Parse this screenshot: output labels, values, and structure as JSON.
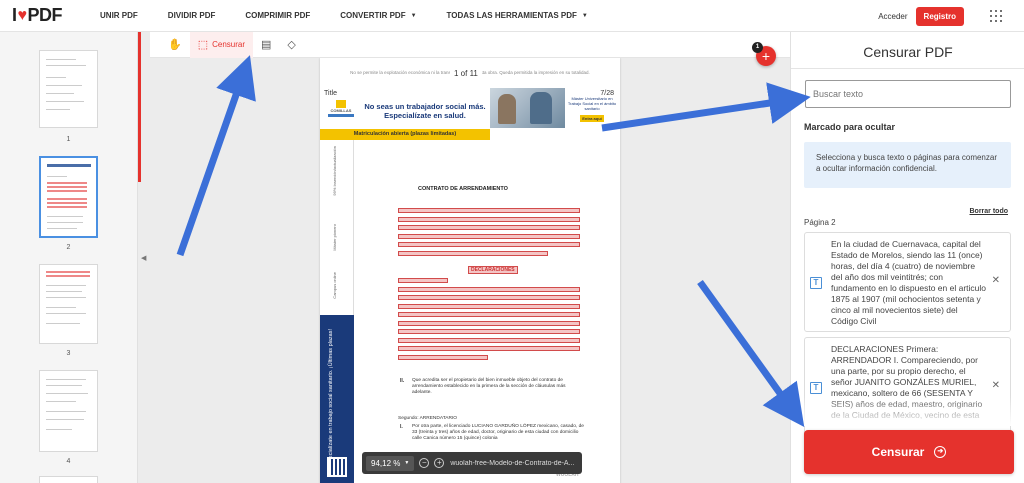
{
  "brand": {
    "logo_left": "I",
    "logo_right": "PDF",
    "accent": "#e5322d"
  },
  "nav": {
    "items": [
      {
        "label": "UNIR PDF"
      },
      {
        "label": "DIVIDIR PDF"
      },
      {
        "label": "COMPRIMIR PDF"
      },
      {
        "label": "CONVERTIR PDF"
      },
      {
        "label": "TODAS LAS HERRAMIENTAS PDF"
      }
    ],
    "login": "Acceder",
    "register": "Registro"
  },
  "thumbnails": [
    {
      "label": "1",
      "selected": false
    },
    {
      "label": "2",
      "selected": true
    },
    {
      "label": "3",
      "selected": false
    },
    {
      "label": "4",
      "selected": false
    }
  ],
  "toolbar": {
    "censor_label": "Censurar"
  },
  "document": {
    "header_line": "No se permite la explotación económica ni la transformación de esta obra. Queda permitida la impresión en su totalidad.",
    "page_counter": "1 of 11",
    "banner_title": "Title",
    "banner_page": "7/28",
    "banner_logo": "COMILLAS",
    "slogan": "No seas un trabajador social más. Especialízate en salud.",
    "side_ad": "Máster Universitario en Trabajo Social en el ámbito sanitario",
    "side_ad_cta": "Entra aquí",
    "enrollment": "Matriculación abierta (plazas limitadas)",
    "side_labels": [
      "99% Inserción/actualización",
      "Máster pionero",
      "Campus online"
    ],
    "blue_col_text": "Especialízate en trabajo social sanitario. ¡Últimas plazas!",
    "heading": "CONTRATO DE ARRENDAMIENTO",
    "declarations": "DECLARACIONES",
    "first_para": "Que acredita ser el propietario del bien inmueble objeto del contrato de arrendamiento establecido en la primera de la sección de cláusulas más adelante.",
    "roman_2": "II.",
    "second_heading": "Segundo: ARRENDATARIO",
    "roman_1": "I.",
    "second_para": "Por otra parte, el licenciado LUCIANO GARDUÑO LÓPEZ mexicano, casado, de 33 (treinta y tres) años de edad, doctor, originario de esta ciudad con domicilio calle Canica número 15 (quince) colonia",
    "footer_brand": "WUOLAH"
  },
  "zoom": {
    "value": "94,12 %",
    "filename": "wuolah-free-Modelo-de-Contrato-de-A..."
  },
  "fab": {
    "badge": "1",
    "symbol": "+"
  },
  "panel": {
    "title": "Censurar PDF",
    "search_placeholder": "Buscar texto",
    "marked_label": "Marcado para ocultar",
    "info": "Selecciona y busca texto o páginas para comenzar a ocultar información confidencial.",
    "clear_all": "Borrar todo",
    "page_label": "Página 2",
    "items": [
      {
        "text": "En la ciudad de Cuernavaca, capital del Estado de Morelos, siendo las 11 (once) horas, del día 4 (cuatro) de noviembre del año dos mil veintitrés; con fundamento en lo dispuesto en el articulo 1875 al 1907 (mil ochocientos setenta y cinco al mil novecientos siete) del Código Civil"
      },
      {
        "text": "DECLARACIONES Primera: ARRENDADOR I. Compareciendo, por una parte, por su propio derecho, el señor JUANITO GONZÁLES MURIEL, mexicano, soltero de 66 (SESENTA Y SEIS) años de edad, maestro, originario de la Ciudad de México, vecino de esta"
      }
    ],
    "censor_button": "Censurar"
  }
}
